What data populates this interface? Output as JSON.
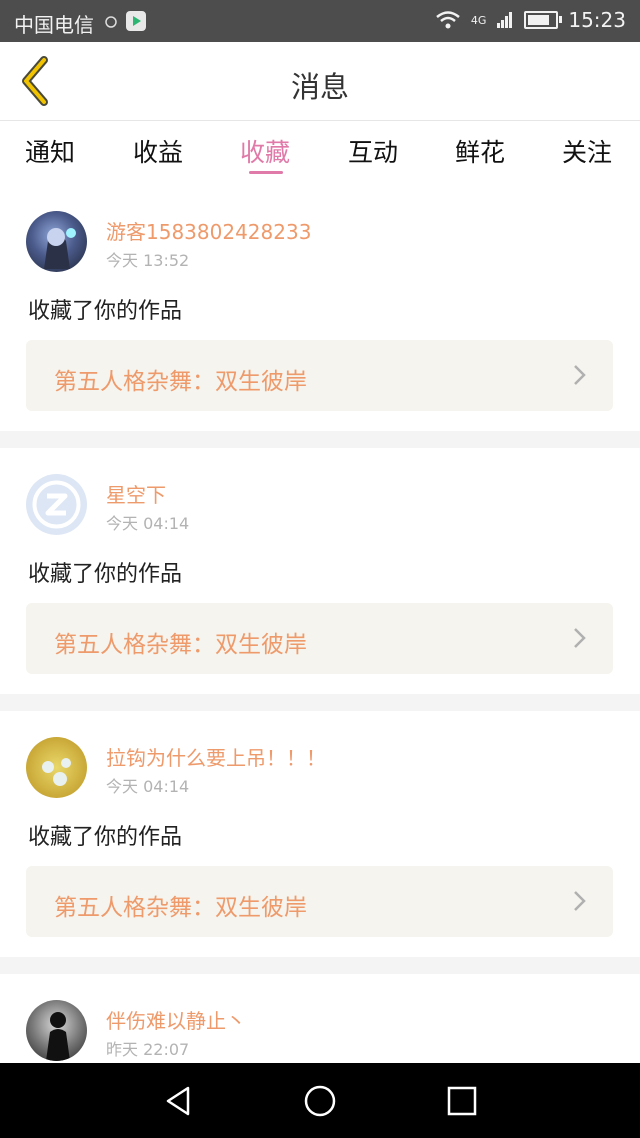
{
  "status_bar": {
    "carrier": "中国电信",
    "network": "4G",
    "time": "15:23"
  },
  "header": {
    "title": "消息"
  },
  "tabs": [
    {
      "label": "通知"
    },
    {
      "label": "收益"
    },
    {
      "label": "收藏",
      "active": true
    },
    {
      "label": "互动"
    },
    {
      "label": "鲜花"
    },
    {
      "label": "关注"
    }
  ],
  "messages": [
    {
      "user": "游客1583802428233",
      "time": "今天 13:52",
      "action": "收藏了你的作品",
      "work": "第五人格杂舞：双生彼岸"
    },
    {
      "user": "星空下",
      "time": "今天 04:14",
      "action": "收藏了你的作品",
      "work": "第五人格杂舞：双生彼岸"
    },
    {
      "user": "拉钩为什么要上吊！！！",
      "time": "今天 04:14",
      "action": "收藏了你的作品",
      "work": "第五人格杂舞：双生彼岸"
    },
    {
      "user": "伴伤难以静止丶",
      "time": "昨天 22:07",
      "action": "",
      "work": ""
    }
  ],
  "colors": {
    "accent": "#e07aa8",
    "name": "#ee9a6b",
    "card_bg": "#f5f4ee"
  }
}
